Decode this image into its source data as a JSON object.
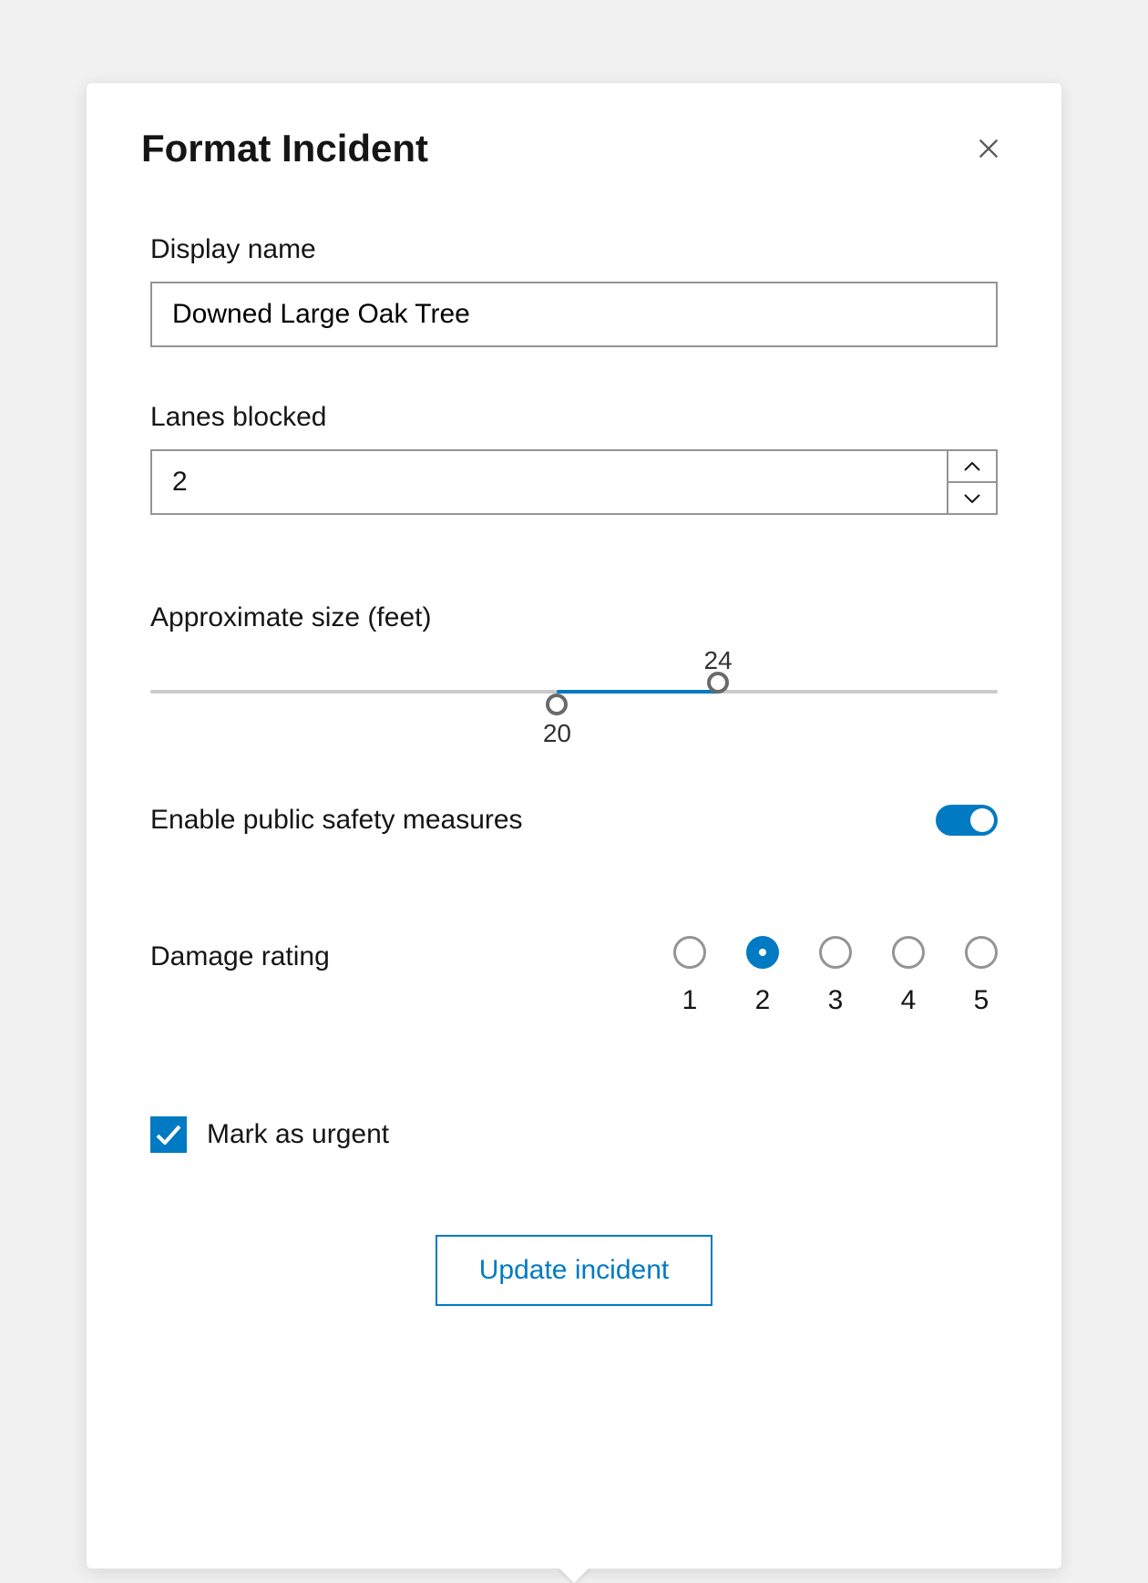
{
  "panel": {
    "title": "Format Incident"
  },
  "fields": {
    "display_name": {
      "label": "Display name",
      "value": "Downed Large Oak Tree"
    },
    "lanes_blocked": {
      "label": "Lanes blocked",
      "value": "2"
    },
    "approx_size": {
      "label": "Approximate size (feet)",
      "min_label": "20",
      "max_label": "24",
      "min_value": 20,
      "max_value": 24,
      "track_min": 0,
      "track_max": 40,
      "min_pos_pct": 48,
      "max_pos_pct": 67
    },
    "public_safety": {
      "label": "Enable public safety measures",
      "enabled": true
    },
    "damage_rating": {
      "label": "Damage rating",
      "options": [
        "1",
        "2",
        "3",
        "4",
        "5"
      ],
      "selected": "2"
    },
    "urgent": {
      "label": "Mark as urgent",
      "checked": true
    }
  },
  "actions": {
    "submit_label": "Update incident"
  }
}
